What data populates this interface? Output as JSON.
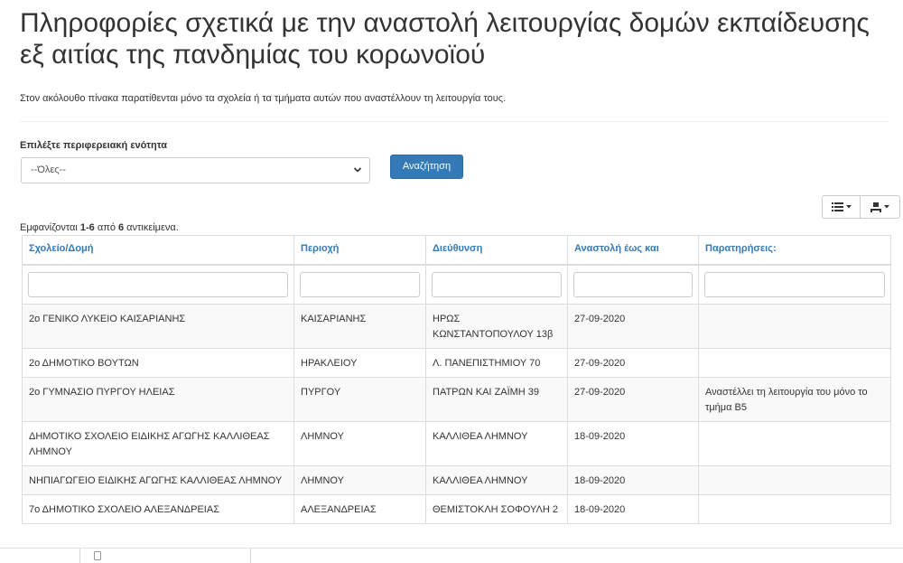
{
  "page": {
    "title": "Πληροφορίες σχετικά με την αναστολή λειτουργίας δομών εκπαίδευσης εξ αιτίας της πανδημίας του κορωνοϊού",
    "intro": "Στον ακόλουθο πίνακα παρατίθενται μόνο τα σχολεία ή τα τμήματα αυτών που αναστέλλουν τη λειτουργία τους."
  },
  "filter": {
    "region_label": "Επιλέξτε περιφερειακή ενότητα",
    "region_selected": "--Όλες--",
    "search_button": "Αναζήτηση"
  },
  "toolbar": {
    "columns_icon": "list-icon",
    "export_icon": "export-icon"
  },
  "summary": {
    "prefix": "Εμφανίζονται ",
    "range": "1-6",
    "middle": " από ",
    "total": "6",
    "suffix": " αντικείμενα."
  },
  "table": {
    "headers": [
      "Σχολείο/Δομή",
      "Περιοχή",
      "Διεύθυνση",
      "Αναστολή έως και",
      "Παρατηρήσεις:"
    ],
    "rows": [
      [
        "2ο ΓΕΝΙΚΟ ΛΥΚΕΙΟ ΚΑΙΣΑΡΙΑΝΗΣ",
        "ΚΑΙΣΑΡΙΑΝΗΣ",
        "ΗΡΩΣ ΚΩΝΣΤΑΝΤΟΠΟΥΛΟΥ 13β",
        "27-09-2020",
        ""
      ],
      [
        "2ο ΔΗΜΟΤΙΚΟ ΒΟΥΤΩΝ",
        "ΗΡΑΚΛΕΙΟΥ",
        "Λ. ΠΑΝΕΠΙΣΤΗΜΙΟΥ 70",
        "27-09-2020",
        ""
      ],
      [
        "2ο ΓΥΜΝΑΣΙΟ ΠΥΡΓΟΥ ΗΛΕΙΑΣ",
        "ΠΥΡΓΟΥ",
        "ΠΑΤΡΩΝ ΚΑΙ ΖΑΪΜΗ 39",
        "27-09-2020",
        "Αναστέλλει τη λειτουργία του μόνο το τμήμα Β5"
      ],
      [
        "ΔΗΜΟΤΙΚΟ ΣΧΟΛΕΙΟ ΕΙΔΙΚΗΣ ΑΓΩΓΗΣ ΚΑΛΛΙΘΕΑΣ ΛΗΜΝΟΥ",
        "ΛΗΜΝΟΥ",
        "ΚΑΛΛΙΘΕΑ ΛΗΜΝΟΥ",
        "18-09-2020",
        ""
      ],
      [
        "ΝΗΠΙΑΓΩΓΕΙΟ ΕΙΔΙΚΗΣ ΑΓΩΓΗΣ ΚΑΛΛΙΘΕΑΣ ΛΗΜΝΟΥ",
        "ΛΗΜΝΟΥ",
        "ΚΑΛΛΙΘΕΑ ΛΗΜΝΟΥ",
        "18-09-2020",
        ""
      ],
      [
        "7ο ΔΗΜΟΤΙΚΟ ΣΧΟΛΕΙΟ ΑΛΕΞΑΝΔΡΕΙΑΣ",
        "ΑΛΕΞΑΝΔΡΕΙΑΣ",
        "ΘΕΜΙΣΤΟΚΛΗ ΣΟΦΟΥΛΗ 2",
        "18-09-2020",
        ""
      ]
    ]
  },
  "colors": {
    "link_blue": "#337ab7",
    "button_blue": "#337ab7",
    "row_stripe": "#f9f9f9",
    "border": "#dddddd"
  }
}
